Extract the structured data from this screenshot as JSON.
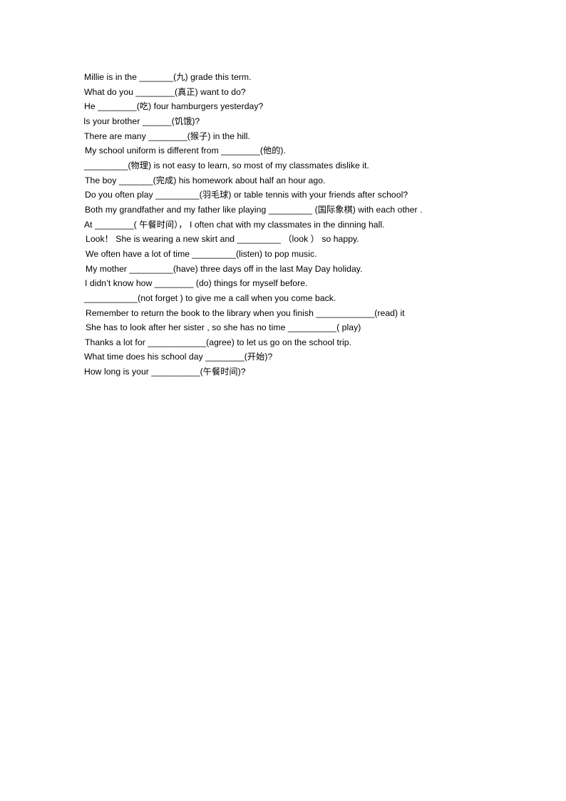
{
  "document": {
    "type": "worksheet",
    "background_color": "#ffffff",
    "text_color": "#000000",
    "lines": [
      {
        "id": "q1",
        "text": "Millie is in the _______(九) grade this term."
      },
      {
        "id": "q2",
        "text": "What do you ________(真正) want to do?"
      },
      {
        "id": "q3",
        "text": "He ________(吃) four hamburgers yesterday?"
      },
      {
        "id": "q4",
        "text": "Is your brother ______(饥饿)?"
      },
      {
        "id": "q5",
        "text": "There are many ________(猴子) in the hill."
      },
      {
        "id": "q6",
        "text": "My school uniform is different from ________(他的)."
      },
      {
        "id": "q7",
        "text": "_________(物理) is not easy to learn, so most of my classmates dislike it."
      },
      {
        "id": "q8",
        "text": "The boy _______(完成) his homework about half an hour ago."
      },
      {
        "id": "q9",
        "text": "Do you often play _________(羽毛球) or table tennis with your friends after school?"
      },
      {
        "id": "q10",
        "text": "Both my grandfather and my father like playing _________ (国际象棋) with each other ."
      },
      {
        "id": "q11",
        "text": "At ________( 午餐时间）， I often chat with my classmates in the dinning hall."
      },
      {
        "id": "q12",
        "text": "Look！ She is wearing a new skirt and _________ （look ） so happy."
      },
      {
        "id": "q13",
        "text": "We often have a lot of time _________(listen) to pop music."
      },
      {
        "id": "q14",
        "text": "My mother _________(have) three days off in the last May Day holiday."
      },
      {
        "id": "q15",
        "text": "I didn’t know how ________ (do) things for myself before."
      },
      {
        "id": "q16",
        "text": "___________(not forget ) to give me a call when you come back."
      },
      {
        "id": "q17",
        "text": "Remember to return the book to the library when you finish ____________(read) it"
      },
      {
        "id": "q18",
        "text": "She has to look after her sister , so she has no time __________( play)"
      },
      {
        "id": "q19",
        "text": "Thanks a lot for ____________(agree) to let us go on the school trip."
      },
      {
        "id": "q20",
        "text": "What time does his school day ________(开始)?"
      },
      {
        "id": "q21",
        "text": "How long is your __________(午餐时间)?"
      }
    ]
  }
}
